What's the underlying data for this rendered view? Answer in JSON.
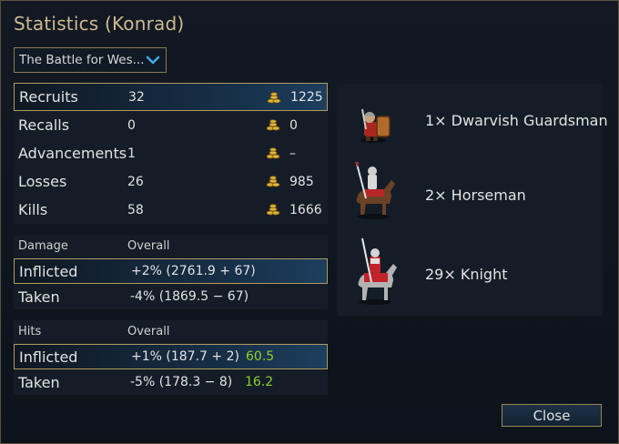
{
  "window": {
    "title": "Statistics (Konrad)"
  },
  "scenario_select": {
    "value": "The Battle for Wes..."
  },
  "summary": {
    "rows": [
      {
        "label": "Recruits",
        "count": "32",
        "gold": "1225"
      },
      {
        "label": "Recalls",
        "count": "0",
        "gold": "0"
      },
      {
        "label": "Advancements",
        "count": "1",
        "gold": "–"
      },
      {
        "label": "Losses",
        "count": "26",
        "gold": "985"
      },
      {
        "label": "Kills",
        "count": "58",
        "gold": "1666"
      }
    ]
  },
  "damage": {
    "header": "Damage",
    "column": "Overall",
    "rows": [
      {
        "label": "Inflicted",
        "value": "+2% (2761.9 + 67)"
      },
      {
        "label": "Taken",
        "value": "-4% (1869.5 − 67)"
      }
    ]
  },
  "hits": {
    "header": "Hits",
    "column": "Overall",
    "rows": [
      {
        "label": "Inflicted",
        "value": "+1% (187.7 + 2)",
        "rating": "60.5"
      },
      {
        "label": "Taken",
        "value": "-5% (178.3 − 8)",
        "rating": "16.2"
      }
    ]
  },
  "units": [
    {
      "label": "1× Dwarvish Guardsman",
      "icon": "dwarvish-guardsman-sprite"
    },
    {
      "label": "2× Horseman",
      "icon": "horseman-sprite"
    },
    {
      "label": "29× Knight",
      "icon": "knight-sprite"
    }
  ],
  "buttons": {
    "close": "Close"
  },
  "colors": {
    "title": "#ceb991",
    "selection_border": "#b09a60",
    "rating_green": "#8ccf2c"
  }
}
